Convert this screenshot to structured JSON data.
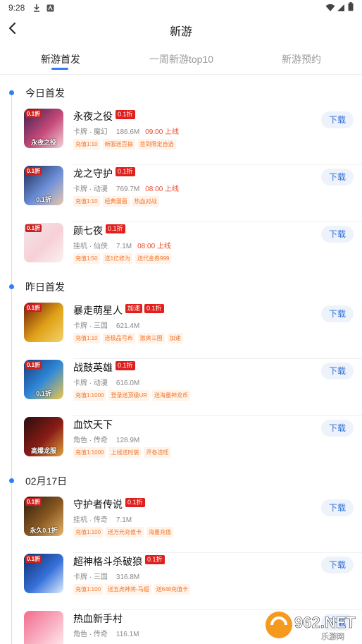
{
  "status_bar": {
    "time": "9:28"
  },
  "header": {
    "title": "新游",
    "back_icon": "chevron-left-icon"
  },
  "tabs": [
    {
      "label": "新游首发",
      "active": true
    },
    {
      "label": "一周新游top10",
      "active": false
    },
    {
      "label": "新游预约",
      "active": false
    }
  ],
  "sections": [
    {
      "title": "今日首发",
      "games": [
        {
          "name": "永夜之役",
          "tags": [
            "0.1折"
          ],
          "category": "卡牌 · 魔幻",
          "size": "186.6M",
          "launch": "09:00 上线",
          "perks": [
            "充值1:10",
            "新服送百抽",
            "签到限定自选"
          ],
          "icon_badge": "0.1折",
          "icon_caption": "永夜之役",
          "download_label": "下载"
        },
        {
          "name": "龙之守护",
          "tags": [
            "0.1折"
          ],
          "category": "卡牌 · 动漫",
          "size": "769.7M",
          "launch": "08:00 上线",
          "perks": [
            "充值1:10",
            "经典漫画",
            "热血对战"
          ],
          "icon_badge": "0.1折",
          "icon_caption": "0.1折",
          "download_label": "下载"
        },
        {
          "name": "颜七夜",
          "tags": [
            "0.1折"
          ],
          "category": "挂机 · 仙侠",
          "size": "7.1M",
          "launch": "08:00 上线",
          "perks": [
            "充值1:50",
            "送1亿修为",
            "送代金券999"
          ],
          "icon_badge": "0.1折",
          "icon_caption": "",
          "download_label": "下载"
        }
      ]
    },
    {
      "title": "昨日首发",
      "games": [
        {
          "name": "暴走萌星人",
          "tags": [
            "加速",
            "0.1折"
          ],
          "category": "卡牌 · 三国",
          "size": "621.4M",
          "launch": "",
          "perks": [
            "充值1:10",
            "送极品弓布",
            "激爽三国",
            "加速"
          ],
          "icon_badge": "0.1折",
          "icon_caption": "",
          "download_label": "下载"
        },
        {
          "name": "战鼓英雄",
          "tags": [
            "0.1折"
          ],
          "category": "卡牌 · 动漫",
          "size": "616.0M",
          "launch": "",
          "perks": [
            "充值1:1000",
            "登录送顶级UR",
            "送海量神龙币"
          ],
          "icon_badge": "0.1折",
          "icon_caption": "0.1折",
          "download_label": "下载"
        },
        {
          "name": "血饮天下",
          "tags": [],
          "category": "角色 · 传奇",
          "size": "128.9M",
          "launch": "",
          "perks": [
            "充值1:1000",
            "上线送时装",
            "开各送旺"
          ],
          "icon_badge": "",
          "icon_caption": "高爆龙服",
          "download_label": "下载"
        }
      ]
    },
    {
      "title": "02月17日",
      "games": [
        {
          "name": "守护者传说",
          "tags": [
            "0.1折"
          ],
          "category": "挂机 · 传奇",
          "size": "7.1M",
          "launch": "",
          "perks": [
            "充值1:100",
            "送万元充值卡",
            "海量充值"
          ],
          "icon_badge": "0.1折",
          "icon_caption": "永久0.1折",
          "download_label": "下载"
        },
        {
          "name": "超神格斗杀破狼",
          "tags": [
            "0.1折"
          ],
          "category": "卡牌 · 三国",
          "size": "316.8M",
          "launch": "",
          "perks": [
            "充值1:100",
            "送五虎神将-马超",
            "送648充值卡"
          ],
          "icon_badge": "0.1折",
          "icon_caption": "",
          "download_label": "下载"
        },
        {
          "name": "热血新手村",
          "tags": [],
          "category": "角色 · 传奇",
          "size": "116.1M",
          "launch": "",
          "perks": [],
          "icon_badge": "",
          "icon_caption": "",
          "download_label": "下载"
        }
      ]
    }
  ],
  "watermark": {
    "brand": "962.NET",
    "sub": "乐游网"
  },
  "colors": {
    "accent": "#2f7ef7",
    "tag_red": "#e0201c",
    "perk_orange": "#f0762b",
    "launch_red": "#e84a2c"
  }
}
